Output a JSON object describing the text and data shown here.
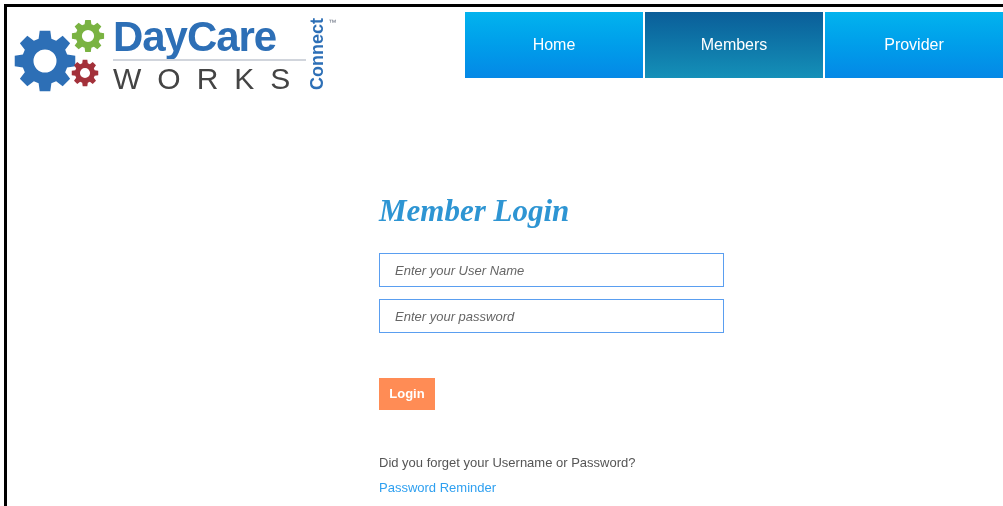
{
  "logo": {
    "name": "DayCare",
    "tagline": "WORKS",
    "sub": "Connect",
    "trademark": "™"
  },
  "nav": [
    {
      "label": "Home",
      "selected": false
    },
    {
      "label": "Members",
      "selected": true
    },
    {
      "label": "Provider",
      "selected": false
    }
  ],
  "login": {
    "title": "Member Login",
    "fields": [
      {
        "placeholder": "Enter your User Name"
      },
      {
        "placeholder": "Enter your password"
      }
    ],
    "button": "Login",
    "help": "Did you forget your Username or Password?",
    "link": "Password Reminder"
  }
}
